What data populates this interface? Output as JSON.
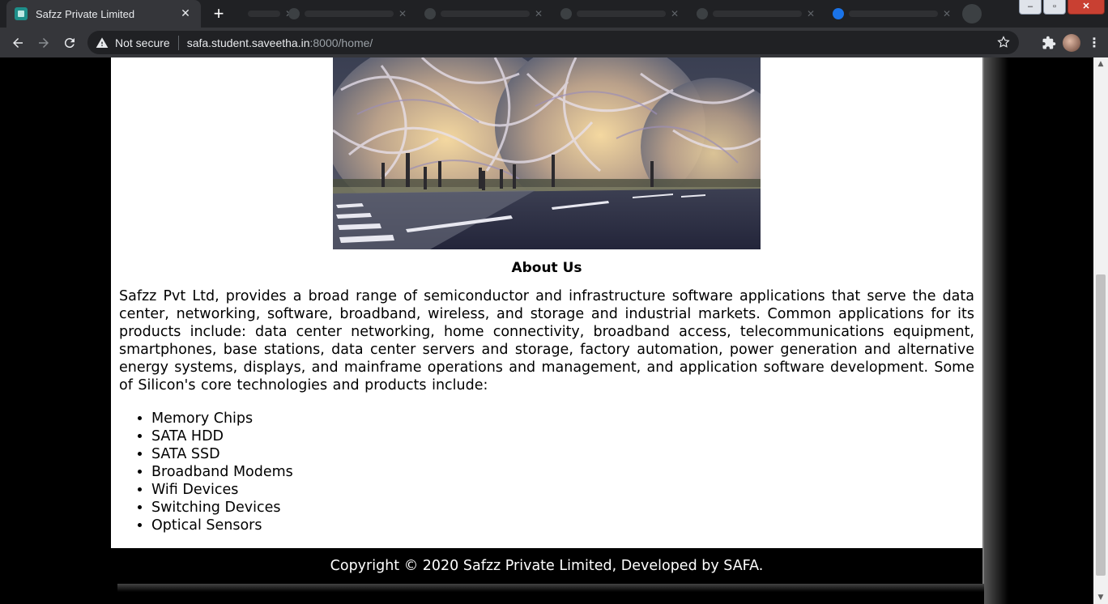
{
  "browser": {
    "tab_title": "Safzz Private Limited",
    "tab_close": "✕",
    "new_tab": "+",
    "security_label": "Not secure",
    "url_host": "safa.student.saveetha.in",
    "url_rest": ":8000/home/"
  },
  "icons": {
    "back": "arrow-left-icon",
    "forward": "arrow-right-icon",
    "reload": "reload-icon",
    "warning": "warning-triangle-icon",
    "star": "star-icon",
    "extensions": "puzzle-icon",
    "menu": "kebab-menu-icon"
  },
  "window": {
    "minimize": "–",
    "maximize": "▫",
    "close": "✕"
  },
  "page": {
    "about_title": "About Us",
    "about_text": "Safzz Pvt Ltd, provides a broad range of semiconductor and infrastructure software applications that serve the data center, networking, software, broadband, wireless, and storage and industrial markets. Common applications for its products include: data center networking, home connectivity, broadband access, telecommunications equipment, smartphones, base stations, data center servers and storage, factory automation, power generation and alternative energy systems, displays, and mainframe operations and management, and application software development. Some of Silicon's core technologies and products include:",
    "products": [
      "Memory Chips",
      "SATA HDD",
      "SATA SSD",
      "Broadband Modems",
      "Wifi Devices",
      "Switching Devices",
      "Optical Sensors"
    ],
    "footer": "Copyright © 2020 Safzz Private Limited, Developed by SAFA."
  },
  "colors": {
    "chrome_dark": "#202124",
    "chrome_toolbar": "#35363a",
    "page_bg": "#ffffff",
    "outer_bg": "#000000"
  }
}
